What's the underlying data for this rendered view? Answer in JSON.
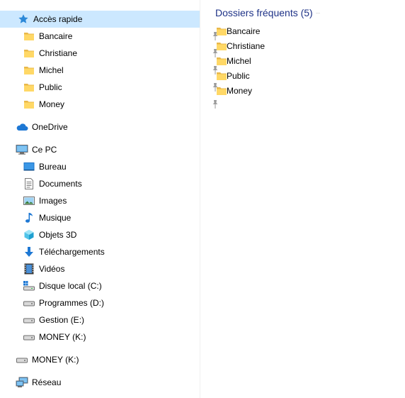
{
  "nav": {
    "quick_access": {
      "label": "Accès rapide",
      "items": [
        {
          "label": "Bancaire",
          "icon": "folder-icon",
          "pinned": true
        },
        {
          "label": "Christiane",
          "icon": "folder-icon",
          "pinned": true
        },
        {
          "label": "Michel",
          "icon": "folder-icon",
          "pinned": true
        },
        {
          "label": "Public",
          "icon": "folder-icon",
          "pinned": true
        },
        {
          "label": "Money",
          "icon": "folder-icon",
          "pinned": true
        }
      ]
    },
    "onedrive": {
      "label": "OneDrive"
    },
    "this_pc": {
      "label": "Ce PC",
      "items": [
        {
          "label": "Bureau",
          "icon": "desktop-icon"
        },
        {
          "label": "Documents",
          "icon": "documents-icon"
        },
        {
          "label": "Images",
          "icon": "pictures-icon"
        },
        {
          "label": "Musique",
          "icon": "music-icon"
        },
        {
          "label": "Objets 3D",
          "icon": "3d-objects-icon"
        },
        {
          "label": "Téléchargements",
          "icon": "downloads-icon"
        },
        {
          "label": "Vidéos",
          "icon": "videos-icon"
        },
        {
          "label": "Disque local (C:)",
          "icon": "system-drive-icon"
        },
        {
          "label": "Programmes (D:)",
          "icon": "drive-icon"
        },
        {
          "label": "Gestion (E:)",
          "icon": "drive-icon"
        },
        {
          "label": "MONEY (K:)",
          "icon": "drive-icon"
        }
      ]
    },
    "removable": {
      "label": "MONEY (K:)"
    },
    "network": {
      "label": "Réseau"
    }
  },
  "main": {
    "group_title": "Dossiers fréquents (5)",
    "folders": [
      "Bancaire",
      "Christiane",
      "Michel",
      "Public",
      "Money"
    ]
  },
  "colors": {
    "selection": "#cce8ff",
    "group_title": "#1e3287",
    "folder": "#ffd866"
  }
}
